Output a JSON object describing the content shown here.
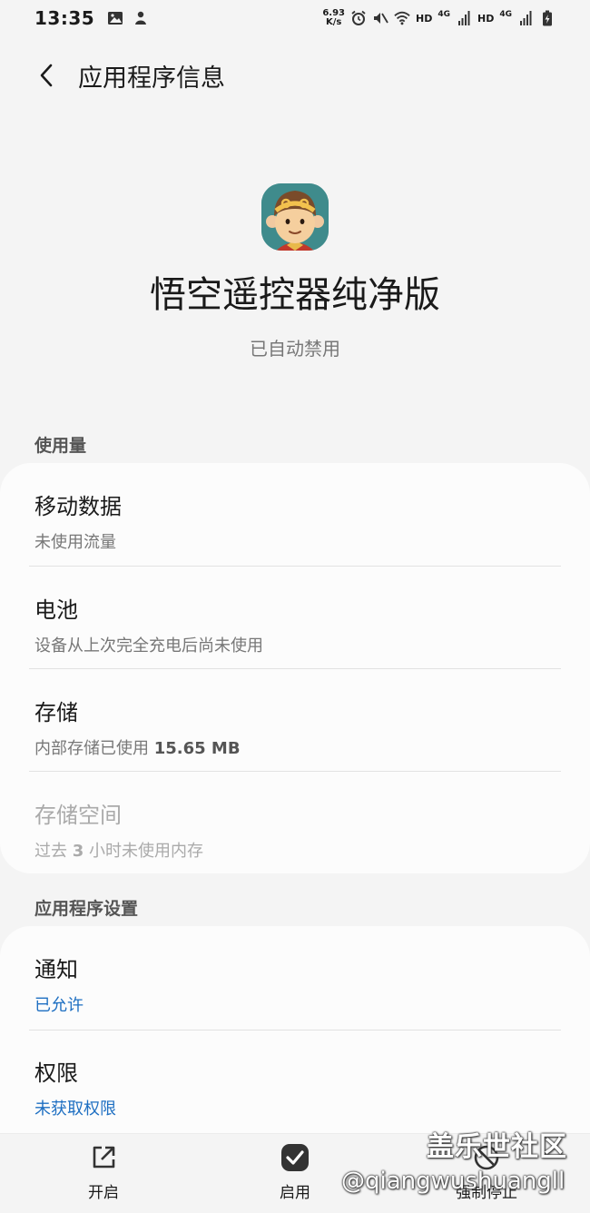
{
  "status_bar": {
    "time": "13:35",
    "speed_value": "6.93",
    "speed_unit": "K/s",
    "sim1_label": "HD",
    "sim1_net": "4G",
    "sim2_label": "HD",
    "sim2_net": "4G"
  },
  "header": {
    "title": "应用程序信息"
  },
  "app": {
    "name": "悟空遥控器纯净版",
    "status": "已自动禁用"
  },
  "usage_section": {
    "title": "使用量",
    "items": [
      {
        "title": "移动数据",
        "subtitle": "未使用流量"
      },
      {
        "title": "电池",
        "subtitle": "设备从上次完全充电后尚未使用"
      },
      {
        "title": "存储",
        "subtitle_prefix": "内部存储已使用 ",
        "subtitle_value": "15.65 MB"
      },
      {
        "title": "存储空间",
        "subtitle_prefix": "过去 ",
        "subtitle_value": "3",
        "subtitle_suffix": " 小时未使用内存"
      }
    ]
  },
  "settings_section": {
    "title": "应用程序设置",
    "items": [
      {
        "title": "通知",
        "subtitle": "已允许"
      },
      {
        "title": "权限",
        "subtitle": "未获取权限"
      }
    ]
  },
  "bottom_bar": {
    "open_label": "开启",
    "enable_label": "启用",
    "force_stop_label": "强制停止"
  },
  "watermark": {
    "line1": "盖乐世社区",
    "line2": "@qiangwushuangll"
  },
  "colors": {
    "background": "#f4f4f4",
    "card": "#fcfcfc",
    "link_blue": "#1e6fc2"
  }
}
